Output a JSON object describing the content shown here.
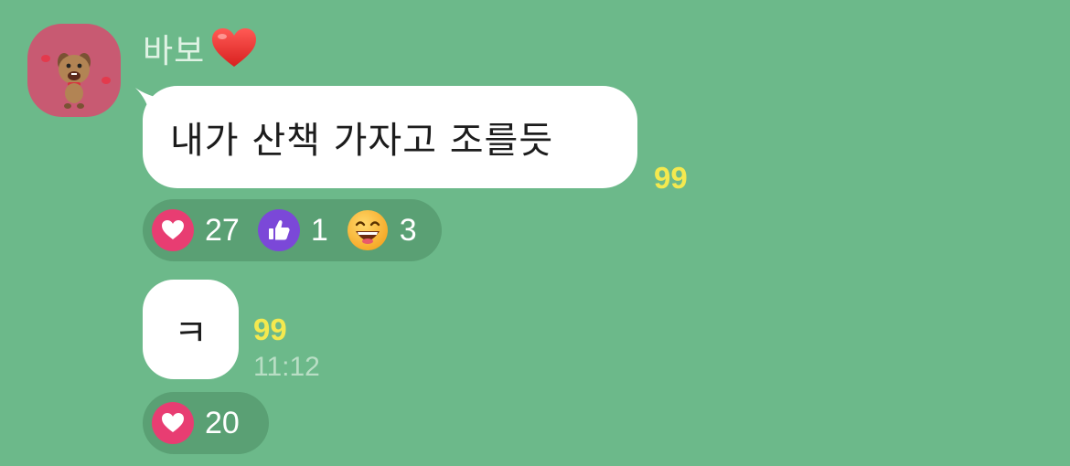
{
  "sender": {
    "name": "바보",
    "name_emoji": "heart-emoji",
    "avatar_icon": "dog-character-icon"
  },
  "messages": [
    {
      "text": "내가 산책 가자고 조를듯",
      "unread_count": "99",
      "reactions": [
        {
          "icon": "heart-reaction-icon",
          "count": "27"
        },
        {
          "icon": "thumbs-up-reaction-icon",
          "count": "1"
        },
        {
          "icon": "laughing-face-reaction-icon",
          "count": "3"
        }
      ]
    },
    {
      "text": "ㅋ",
      "unread_count": "99",
      "time": "11:12",
      "reactions": [
        {
          "icon": "heart-reaction-icon",
          "count": "20"
        }
      ]
    }
  ],
  "colors": {
    "background": "#6cb98a",
    "bubble": "#ffffff",
    "unread": "#f4e94f",
    "heart": "#e83d72",
    "thumb": "#7b48d8"
  }
}
